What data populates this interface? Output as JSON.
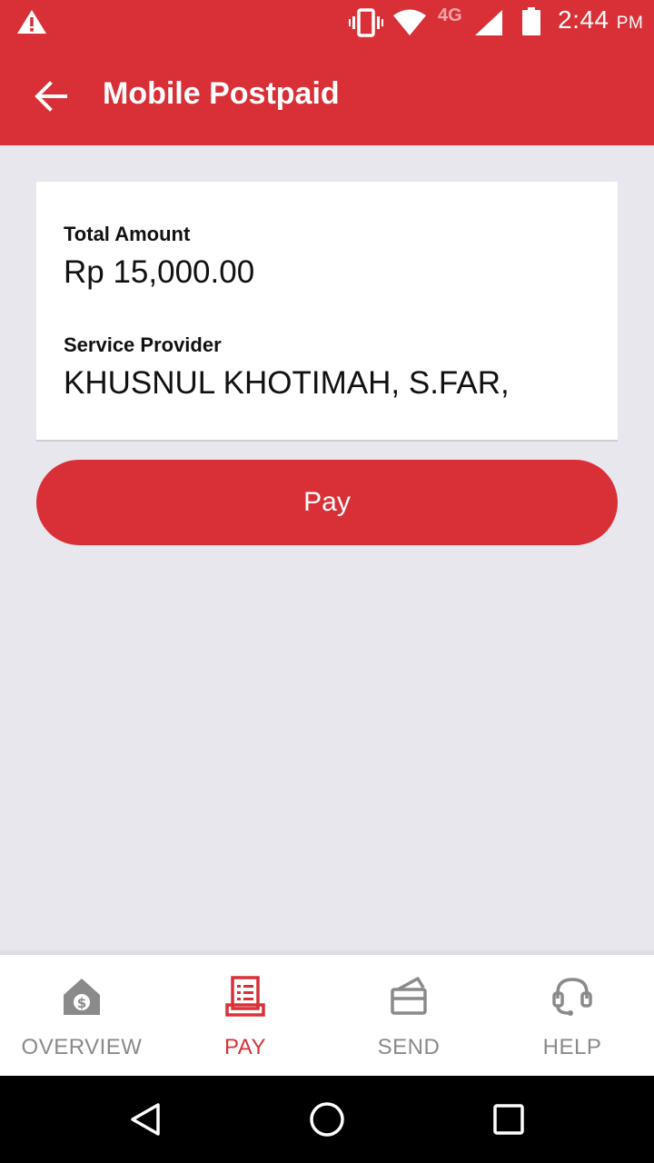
{
  "status_bar": {
    "network_label": "4G",
    "time": "2:44",
    "ampm": "PM",
    "icons": [
      "warning-icon",
      "vibrate-icon",
      "wifi-icon",
      "signal-icon",
      "battery-icon"
    ]
  },
  "app_bar": {
    "title": "Mobile Postpaid",
    "back_icon": "arrow-left-icon",
    "background_color": "#d93038"
  },
  "details": {
    "total_amount_label": "Total Amount",
    "total_amount_value": "Rp 15,000.00",
    "service_provider_label": "Service Provider",
    "service_provider_value": "KHUSNUL KHOTIMAH, S.FAR,"
  },
  "pay_button": {
    "label": "Pay"
  },
  "bottom_nav": {
    "active": "PAY",
    "items": [
      {
        "label": "OVERVIEW",
        "icon": "home-dollar-icon"
      },
      {
        "label": "PAY",
        "icon": "bill-icon"
      },
      {
        "label": "SEND",
        "icon": "card-send-icon"
      },
      {
        "label": "HELP",
        "icon": "headset-icon"
      }
    ]
  },
  "system_nav": {
    "icons": [
      "back-triangle-icon",
      "home-circle-icon",
      "recents-square-icon"
    ]
  }
}
